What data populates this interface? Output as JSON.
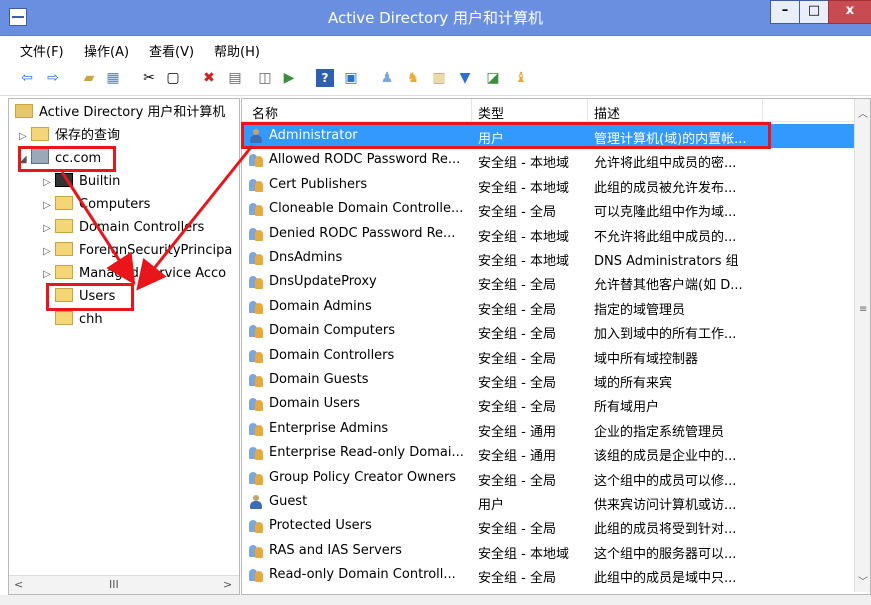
{
  "window": {
    "title": "Active Directory 用户和计算机"
  },
  "menu": [
    "文件(F)",
    "操作(A)",
    "查看(V)",
    "帮助(H)"
  ],
  "toolbar_icons": [
    "back-icon",
    "forward-icon",
    "folder-up-icon",
    "show-console-tree-icon",
    "cut-icon",
    "copy-icon",
    "delete-icon",
    "properties-icon",
    "refresh-icon",
    "export-list-icon",
    "help-icon",
    "console-icon",
    "new-user-icon",
    "new-group-icon",
    "new-ou-icon",
    "filter-icon",
    "find-icon",
    "add-to-group-icon"
  ],
  "tree": {
    "root": "Active Directory 用户和计算机",
    "saved_queries": "保存的查询",
    "domain": "cc.com",
    "children": [
      "Builtin",
      "Computers",
      "Domain Controllers",
      "ForeignSecurityPrincipa",
      "Managed Service Acco",
      "Users",
      "chh"
    ]
  },
  "list": {
    "columns": [
      "名称",
      "类型",
      "描述"
    ],
    "rows": [
      {
        "name": "Administrator",
        "type": "用户",
        "desc": "管理计算机(域)的内置帐...",
        "icon": "user"
      },
      {
        "name": "Allowed RODC Password Re...",
        "type": "安全组 - 本地域",
        "desc": "允许将此组中成员的密...",
        "icon": "group"
      },
      {
        "name": "Cert Publishers",
        "type": "安全组 - 本地域",
        "desc": "此组的成员被允许发布...",
        "icon": "group"
      },
      {
        "name": "Cloneable Domain Controlle...",
        "type": "安全组 - 全局",
        "desc": "可以克隆此组中作为域...",
        "icon": "group"
      },
      {
        "name": "Denied RODC Password Re...",
        "type": "安全组 - 本地域",
        "desc": "不允许将此组中成员的...",
        "icon": "group"
      },
      {
        "name": "DnsAdmins",
        "type": "安全组 - 本地域",
        "desc": "DNS Administrators 组",
        "icon": "group"
      },
      {
        "name": "DnsUpdateProxy",
        "type": "安全组 - 全局",
        "desc": "允许替其他客户端(如 D...",
        "icon": "group"
      },
      {
        "name": "Domain Admins",
        "type": "安全组 - 全局",
        "desc": "指定的域管理员",
        "icon": "group"
      },
      {
        "name": "Domain Computers",
        "type": "安全组 - 全局",
        "desc": "加入到域中的所有工作...",
        "icon": "group"
      },
      {
        "name": "Domain Controllers",
        "type": "安全组 - 全局",
        "desc": "域中所有域控制器",
        "icon": "group"
      },
      {
        "name": "Domain Guests",
        "type": "安全组 - 全局",
        "desc": "域的所有来宾",
        "icon": "group"
      },
      {
        "name": "Domain Users",
        "type": "安全组 - 全局",
        "desc": "所有域用户",
        "icon": "group"
      },
      {
        "name": "Enterprise Admins",
        "type": "安全组 - 通用",
        "desc": "企业的指定系统管理员",
        "icon": "group"
      },
      {
        "name": "Enterprise Read-only Domai...",
        "type": "安全组 - 通用",
        "desc": "该组的成员是企业中的...",
        "icon": "group"
      },
      {
        "name": "Group Policy Creator Owners",
        "type": "安全组 - 全局",
        "desc": "这个组中的成员可以修...",
        "icon": "group"
      },
      {
        "name": "Guest",
        "type": "用户",
        "desc": "供来宾访问计算机或访...",
        "icon": "user"
      },
      {
        "name": "Protected Users",
        "type": "安全组 - 全局",
        "desc": "此组的成员将受到针对...",
        "icon": "group"
      },
      {
        "name": "RAS and IAS Servers",
        "type": "安全组 - 本地域",
        "desc": "这个组中的服务器可以...",
        "icon": "group"
      },
      {
        "name": "Read-only Domain Controll...",
        "type": "安全组 - 全局",
        "desc": "此组中的成员是域中只...",
        "icon": "group"
      }
    ]
  },
  "scroll": {
    "left_label": "III"
  },
  "colors": {
    "titlebar": "#6a8fe0",
    "selection": "#3399ff",
    "highlight": "#e8151b"
  }
}
